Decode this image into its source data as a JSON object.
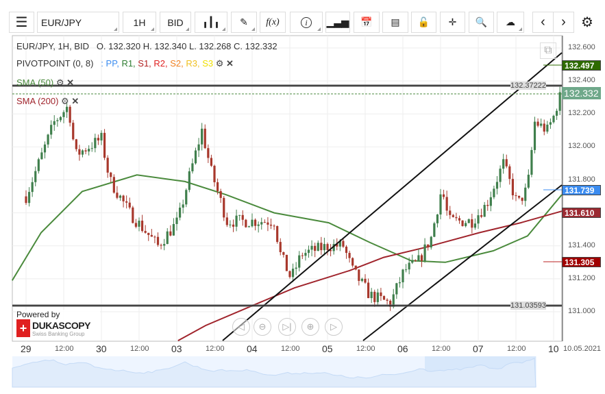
{
  "toolbar": {
    "instrument": "EUR/JPY",
    "period": "1H",
    "side": "BID",
    "fx_label": "f(x)"
  },
  "legend": {
    "header": "EUR/JPY, 1H, BID",
    "ohlc": "O. 132.320 H. 132.340 L. 132.268 C. 132.332",
    "pivot": "PIVOTPOINT (0, 8)",
    "pivot_sep": ":",
    "pivot_items": [
      {
        "t": "PP",
        "c": "#3b8cf0"
      },
      {
        "t": "R1",
        "c": "#2e7d32"
      },
      {
        "t": "S1",
        "c": "#b22222"
      },
      {
        "t": "R2",
        "c": "#e02020"
      },
      {
        "t": "S2",
        "c": "#f08020"
      },
      {
        "t": "R3",
        "c": "#f0c020"
      },
      {
        "t": "S3",
        "c": "#f0e000"
      }
    ],
    "sma50": "SMA (50)",
    "sma200": "SMA (200)"
  },
  "price_axis": [
    "132.600",
    "132.400",
    "132.200",
    "132.000",
    "131.800",
    "131.600",
    "131.400",
    "131.200",
    "131.000"
  ],
  "price_tags": {
    "r1": "132.497",
    "current": "132.332",
    "pp": "131.739",
    "sma200": "131.610",
    "s1": "131.305"
  },
  "hlines": {
    "top": "132.37222",
    "bottom": "131.03593"
  },
  "time_axis": [
    {
      "t": "29",
      "d": true
    },
    {
      "t": "12:00"
    },
    {
      "t": "30",
      "d": true
    },
    {
      "t": "12:00"
    },
    {
      "t": "03",
      "d": true
    },
    {
      "t": "12:00"
    },
    {
      "t": "04",
      "d": true
    },
    {
      "t": "12:00"
    },
    {
      "t": "05",
      "d": true
    },
    {
      "t": "12:00"
    },
    {
      "t": "06",
      "d": true
    },
    {
      "t": "12:00"
    },
    {
      "t": "07",
      "d": true
    },
    {
      "t": "12:00"
    },
    {
      "t": "10",
      "d": true
    }
  ],
  "date_label": "10.05.2021",
  "branding": {
    "powered": "Powered by",
    "name": "DUKASCOPY",
    "sub": "Swiss Banking Group"
  },
  "colors": {
    "up": "#3f7f4c",
    "down": "#a8382c",
    "sma50": "#4a8a3c",
    "sma200": "#a0242c"
  },
  "chart_data": {
    "type": "candlestick",
    "price_path_hours": [
      [
        0,
        131.7
      ],
      [
        9,
        132.15
      ],
      [
        13.5,
        132.25
      ],
      [
        15.7,
        131.95
      ],
      [
        24,
        132.05
      ],
      [
        26.6,
        131.8
      ],
      [
        33,
        131.6
      ],
      [
        42,
        131.4
      ],
      [
        48.4,
        131.55
      ],
      [
        51.7,
        131.8
      ],
      [
        56,
        132.1
      ],
      [
        59,
        131.85
      ],
      [
        64,
        131.55
      ],
      [
        72,
        131.55
      ],
      [
        79,
        131.55
      ],
      [
        81,
        131.35
      ],
      [
        84.4,
        131.2
      ],
      [
        87.7,
        131.35
      ],
      [
        96.4,
        131.4
      ],
      [
        101,
        131.4
      ],
      [
        104,
        131.25
      ],
      [
        109.5,
        131.1
      ],
      [
        116,
        131.05
      ],
      [
        120.4,
        131.25
      ],
      [
        124.8,
        131.3
      ],
      [
        129,
        131.45
      ],
      [
        132.4,
        131.75
      ],
      [
        134.6,
        131.55
      ],
      [
        142,
        131.55
      ],
      [
        146.6,
        131.65
      ],
      [
        152,
        131.9
      ],
      [
        156.5,
        131.65
      ],
      [
        159.7,
        131.75
      ],
      [
        162,
        132.15
      ],
      [
        166,
        132.1
      ],
      [
        168.4,
        132.2
      ],
      [
        170,
        132.332
      ]
    ],
    "sma50": [
      [
        -4.4,
        131.19
      ],
      [
        4.8,
        131.48
      ],
      [
        17.9,
        131.73
      ],
      [
        35.3,
        131.83
      ],
      [
        50.6,
        131.79
      ],
      [
        63.7,
        131.71
      ],
      [
        79,
        131.6
      ],
      [
        96.4,
        131.54
      ],
      [
        109.5,
        131.42
      ],
      [
        122.6,
        131.31
      ],
      [
        133.5,
        131.3
      ],
      [
        148.8,
        131.37
      ],
      [
        159.7,
        131.46
      ],
      [
        170.6,
        131.71
      ]
    ],
    "sma200": [
      [
        48.4,
        130.825
      ],
      [
        57.2,
        130.917
      ],
      [
        72.4,
        131.04
      ],
      [
        85.5,
        131.145
      ],
      [
        103,
        131.25
      ],
      [
        113.9,
        131.33
      ],
      [
        127,
        131.39
      ],
      [
        144.4,
        131.48
      ],
      [
        157.5,
        131.54
      ],
      [
        170.6,
        131.61
      ]
    ],
    "ylim": [
      130.8,
      132.65
    ]
  }
}
